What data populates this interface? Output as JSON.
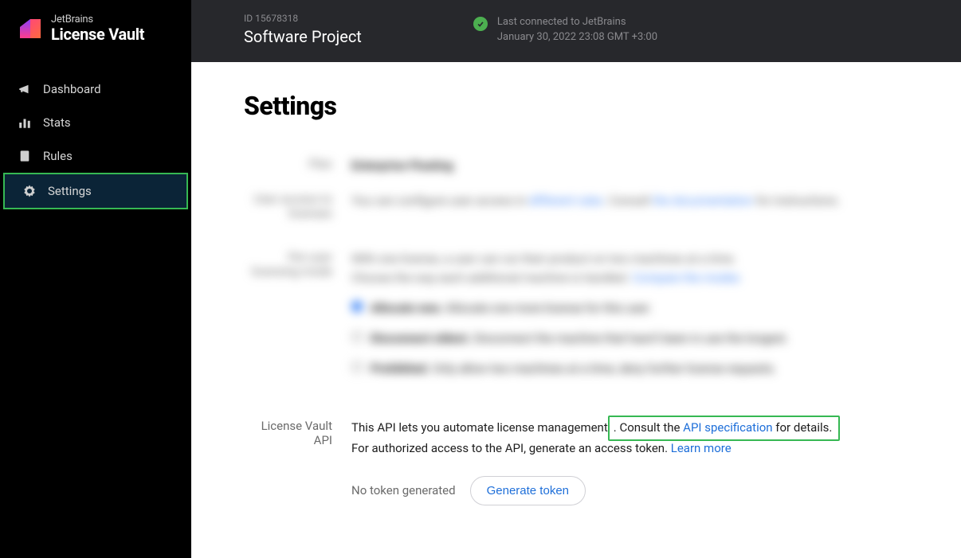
{
  "logo": {
    "brand": "JetBrains",
    "product": "License Vault"
  },
  "sidebar": {
    "items": [
      {
        "label": "Dashboard"
      },
      {
        "label": "Stats"
      },
      {
        "label": "Rules"
      },
      {
        "label": "Settings"
      }
    ]
  },
  "header": {
    "id_prefix": "ID ",
    "id": "15678318",
    "title": "Software Project",
    "connected_label": "Last connected to JetBrains",
    "connected_time": "January 30, 2022 23:08 GMT +3:00"
  },
  "page": {
    "title": "Settings"
  },
  "api": {
    "label": "License Vault API",
    "desc1_prefix": "This API lets you automate license management",
    "desc1_consult_before": ". ",
    "consult": "Consult the ",
    "spec_link": "API specification",
    "consult_after": " for details.",
    "desc2": "For authorized access to the API, generate an access token. ",
    "learn_more": "Learn more",
    "no_token": "No token generated",
    "gen_button": "Generate token"
  }
}
